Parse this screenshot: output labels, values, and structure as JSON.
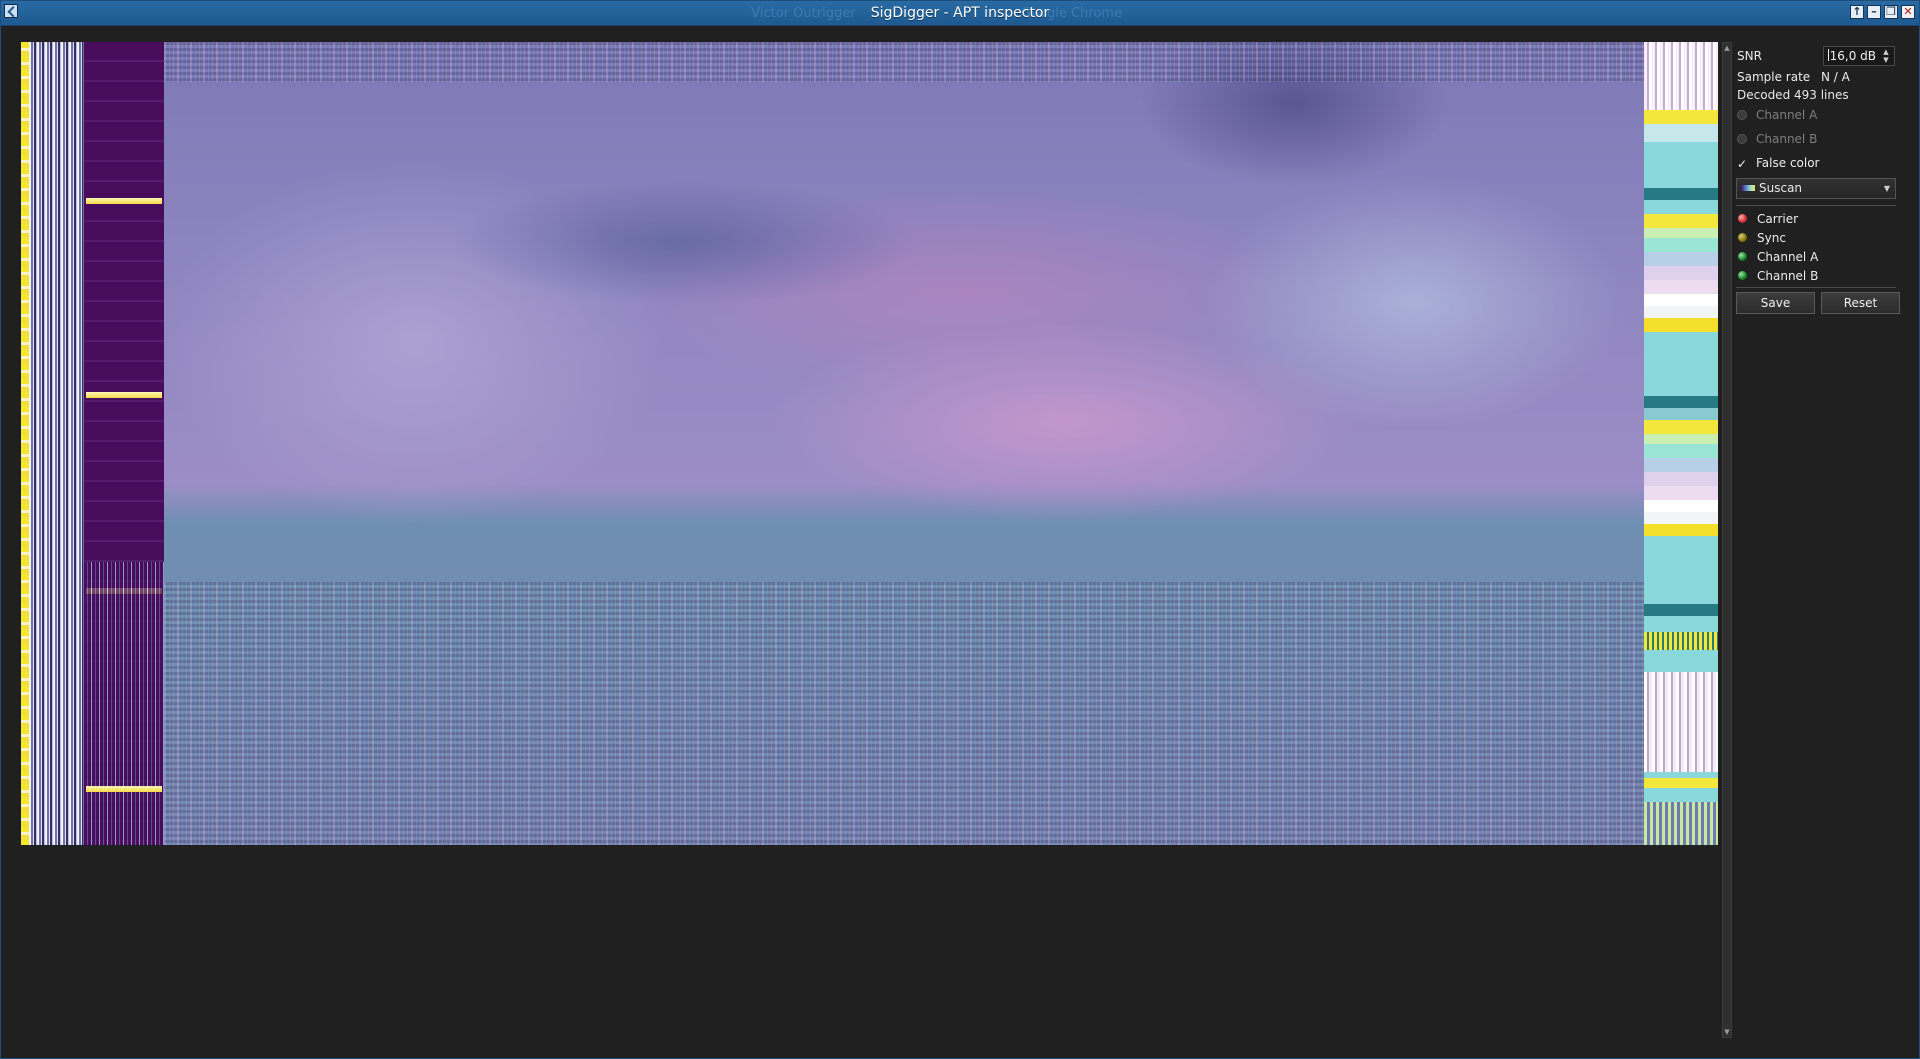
{
  "window": {
    "title": "SigDigger - APT inspector",
    "ghost_title_left": "Víctor Outrigger",
    "ghost_title_right": "Google Chrome",
    "buttons": {
      "up": "↑",
      "minimize": "–",
      "maximize": "❐",
      "close": "✕"
    }
  },
  "panel": {
    "snr_label": "SNR",
    "snr_value": "16,0 dB",
    "sample_rate_label": "Sample rate",
    "sample_rate_value": "N / A",
    "decoded_lines": "Decoded 493 lines",
    "channels": [
      {
        "label": "Channel A",
        "enabled": false
      },
      {
        "label": "Channel B",
        "enabled": false
      }
    ],
    "false_color_label": "False color",
    "false_color_checked": true,
    "palette": {
      "selected": "Suscan"
    },
    "indicators": [
      {
        "label": "Carrier",
        "color": "#d9343b"
      },
      {
        "label": "Sync",
        "color": "#8a7d12"
      },
      {
        "label": "Channel A",
        "color": "#1b8a2a"
      },
      {
        "label": "Channel B",
        "color": "#1b8a2a"
      }
    ],
    "save_label": "Save",
    "reset_label": "Reset"
  },
  "colors": {
    "titlebar": "#1e5a91",
    "background": "#202020",
    "sync_purple": "#480c5c",
    "telemetry_cyan": "#8ad8dc",
    "telemetry_yellow": "#f4e82f"
  }
}
